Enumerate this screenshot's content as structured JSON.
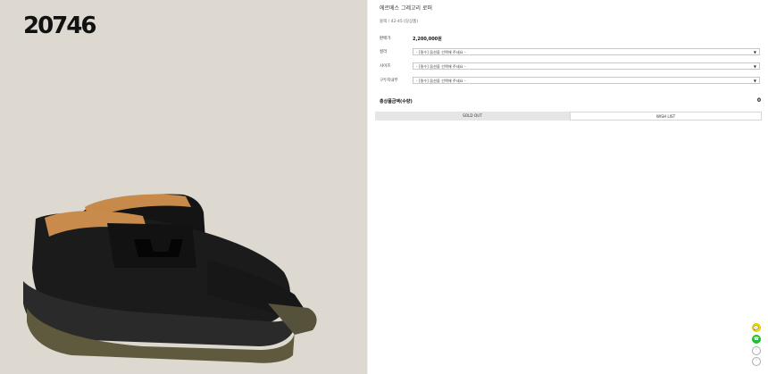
{
  "product_image": {
    "code": "20746"
  },
  "product": {
    "title": "에르메스 그레고리 로퍼",
    "subtitle": "블랙 / 42-45 (당상품)",
    "price_label": "판매가",
    "price_value": "2,200,000원",
    "options": [
      {
        "label": "컬러",
        "selected": "- [필수] 옵션을 선택해 주세요 -"
      },
      {
        "label": "사이즈",
        "selected": "- [필수] 옵션을 선택해 주세요 -"
      },
      {
        "label": "구두지내부",
        "selected": "- [필수] 옵션을 선택해 주세요 -"
      }
    ],
    "total_label": "총상품금액(수량)",
    "total_value": "0"
  },
  "actions": {
    "sold_out": "SOLD OUT",
    "wish_list": "WISH LIST"
  },
  "floating": {
    "kakao": "💬",
    "talk": "☎",
    "up": "˄",
    "down": "˅"
  },
  "icons": [
    "chevron-down-icon",
    "kakao-icon",
    "talk-icon",
    "arrow-up-icon",
    "arrow-down-icon"
  ]
}
